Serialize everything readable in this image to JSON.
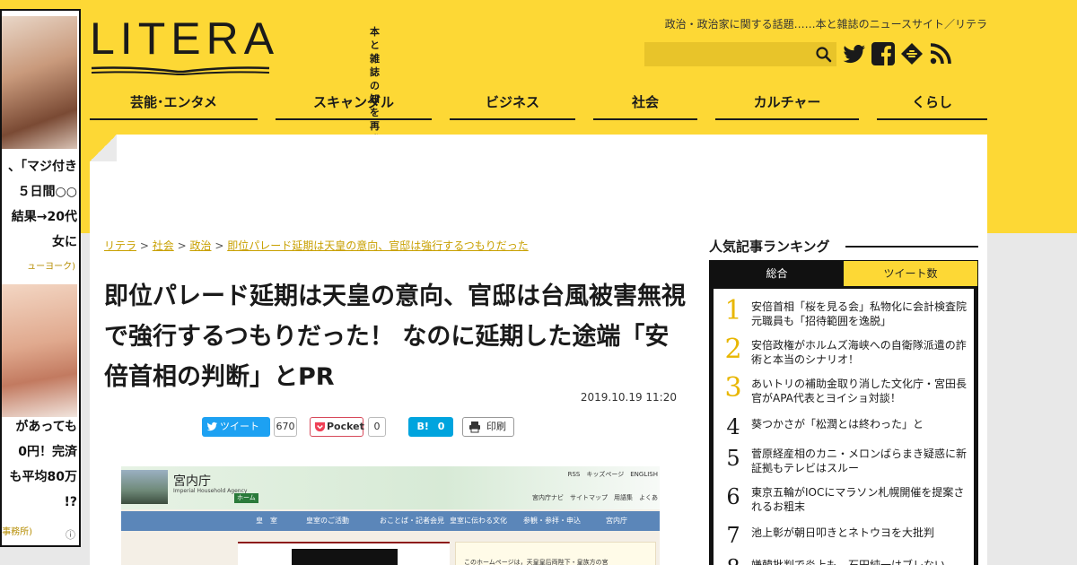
{
  "colors": {
    "brand_yellow": "#fdd835",
    "text_dark": "#1a1a1a",
    "link_gold": "#c8a000",
    "twitter_blue": "#1da1f2",
    "hatena_blue": "#00a4de"
  },
  "ad": {
    "unit1": {
      "lines": [
        "、「マジ付き",
        "５日間○○",
        "結果→20代",
        "女に"
      ],
      "source": "ューヨーク)"
    },
    "unit2": {
      "lines": [
        "があっても",
        "0円！完済",
        "も平均80万",
        "!?"
      ],
      "source": "律事務所)"
    },
    "mark": "ⓘ"
  },
  "header": {
    "logo": "LITERA",
    "tagline": [
      "本と雑誌の",
      "知を再発見"
    ],
    "site_description": "政治・政治家に関する話題……本と雑誌のニュースサイト／リテラ",
    "search": {
      "placeholder": "",
      "icon": "search-icon"
    },
    "social_icons": [
      "twitter-icon",
      "facebook-icon",
      "feedly-icon",
      "rss-icon"
    ]
  },
  "nav": [
    {
      "label": "芸能･エンタメ"
    },
    {
      "label": "スキャンダル"
    },
    {
      "label": "ビジネス"
    },
    {
      "label": "社会"
    },
    {
      "label": "カルチャー"
    },
    {
      "label": "くらし"
    }
  ],
  "breadcrumb": {
    "items": [
      "リテラ",
      "社会",
      "政治",
      "即位パレード延期は天皇の意向、官邸は強行するつもりだった"
    ],
    "separator": ">"
  },
  "article": {
    "title": "即位パレード延期は天皇の意向、官邸は台風被害無視で強行するつもりだった！ なのに延期した途端「安倍首相の判断」とPR",
    "date": "2019.10.19 11:20"
  },
  "share": {
    "tweet_label": "ツイート",
    "tweet_count": "670",
    "pocket_label": "Pocket",
    "pocket_count": "0",
    "hatena_label": "B!",
    "hatena_count": "0",
    "print_label": "印刷"
  },
  "embed": {
    "title": "宮内庁",
    "subtitle": "Imperial Household Agency",
    "home": "ホーム",
    "links_top": "RSS　キッズページ　ENGLISH",
    "links_sub": "宮内庁ナビ　サイトマップ　用語集　よくあ",
    "nav": [
      "皇　室",
      "皇室のご活動",
      "おことば・記者会見",
      "皇室に伝わる文化",
      "参観・参拝・申込",
      "宮内庁"
    ],
    "body_text": "このホームページは，天皇皇后両陛下・皇族方の宮"
  },
  "ranking": {
    "heading": "人気記事ランキング",
    "tabs": [
      "総合",
      "ツイート数"
    ],
    "items": [
      {
        "rank": "1",
        "text": "安倍首相「桜を見る会」私物化に会計検査院元職員も「招待範囲を逸脱」"
      },
      {
        "rank": "2",
        "text": "安倍政権がホルムズ海峡への自衛隊派遣の詐術と本当のシナリオ！"
      },
      {
        "rank": "3",
        "text": "あいトリの補助金取り消した文化庁・宮田長官がAPA代表とヨイショ対談！"
      },
      {
        "rank": "4",
        "text": "葵つかさが「松潤とは終わった」と"
      },
      {
        "rank": "5",
        "text": "菅原経産相のカニ・メロンばらまき疑惑に新証拠もテレビはスルー"
      },
      {
        "rank": "6",
        "text": "東京五輪がIOCにマラソン札幌開催を提案されるお粗末"
      },
      {
        "rank": "7",
        "text": "池上彰が朝日叩きとネトウヨを大批判"
      },
      {
        "rank": "8",
        "text": "嫌韓批判で炎上も…石田純一はブレない"
      }
    ]
  }
}
